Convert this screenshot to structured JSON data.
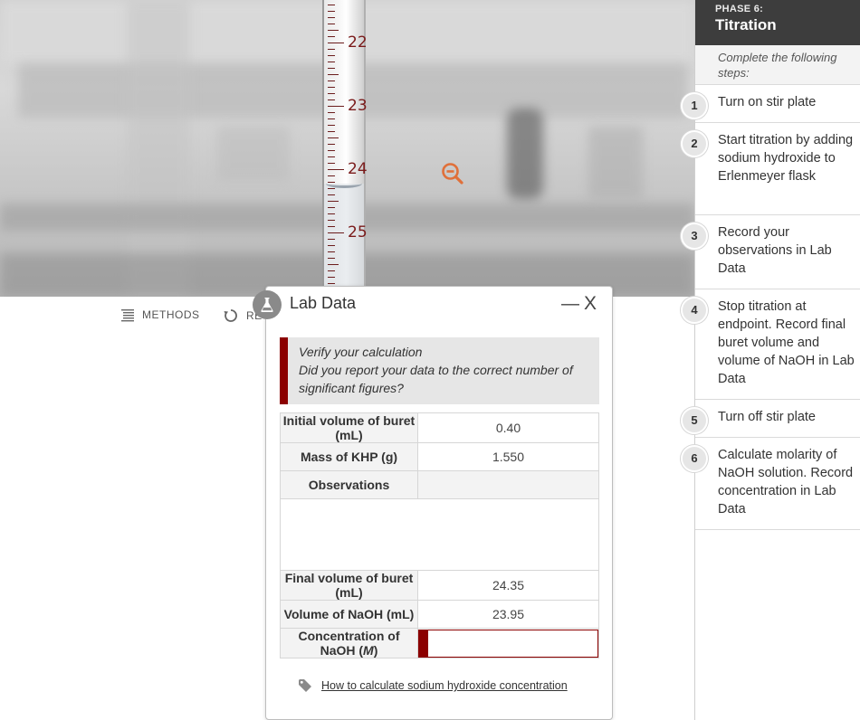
{
  "scene": {
    "buret_ticks": [
      "22",
      "23",
      "24",
      "25"
    ],
    "zoom_icon": "zoom-out-icon"
  },
  "toolbar": {
    "methods_label": "METHODS",
    "methods_icon": "list-icon",
    "reset_label": "RE",
    "reset_icon": "reset-icon"
  },
  "phase": {
    "label": "PHASE 6:",
    "title": "Titration",
    "intro": "Complete the following steps:",
    "steps": [
      {
        "num": "1",
        "text": "Turn on stir plate"
      },
      {
        "num": "2",
        "text": "Start titration by adding sodium hydroxide to Erlenmeyer flask"
      },
      {
        "num": "3",
        "text": "Record your observations in Lab Data"
      },
      {
        "num": "4",
        "text": "Stop titration at endpoint. Record final buret volume and volume of NaOH in Lab Data"
      },
      {
        "num": "5",
        "text": "Turn off stir plate"
      },
      {
        "num": "6",
        "text": "Calculate molarity of NaOH solution. Record concentration in Lab Data"
      }
    ]
  },
  "lab_data": {
    "title": "Lab Data",
    "minimize": "—",
    "close": "X",
    "alert_line1": "Verify your calculation",
    "alert_line2": "Did you report your data to the correct number of significant figures?",
    "rows": {
      "initial_volume": {
        "label": "Initial volume of buret (mL)",
        "value": "0.40"
      },
      "mass_khp": {
        "label": "Mass of KHP (g)",
        "value": "1.550"
      },
      "observations": {
        "label": "Observations",
        "value": ""
      },
      "final_volume": {
        "label": "Final volume of buret (mL)",
        "value": "24.35"
      },
      "volume_naoh": {
        "label": "Volume of NaOH (mL)",
        "value": "23.95"
      },
      "concentration": {
        "label_prefix": "Concentration of NaOH (",
        "label_unit": "M",
        "label_suffix": ")",
        "value": ""
      }
    },
    "help_link": "How to calculate sodium hydroxide concentration",
    "accent_color": "#8b0000"
  }
}
